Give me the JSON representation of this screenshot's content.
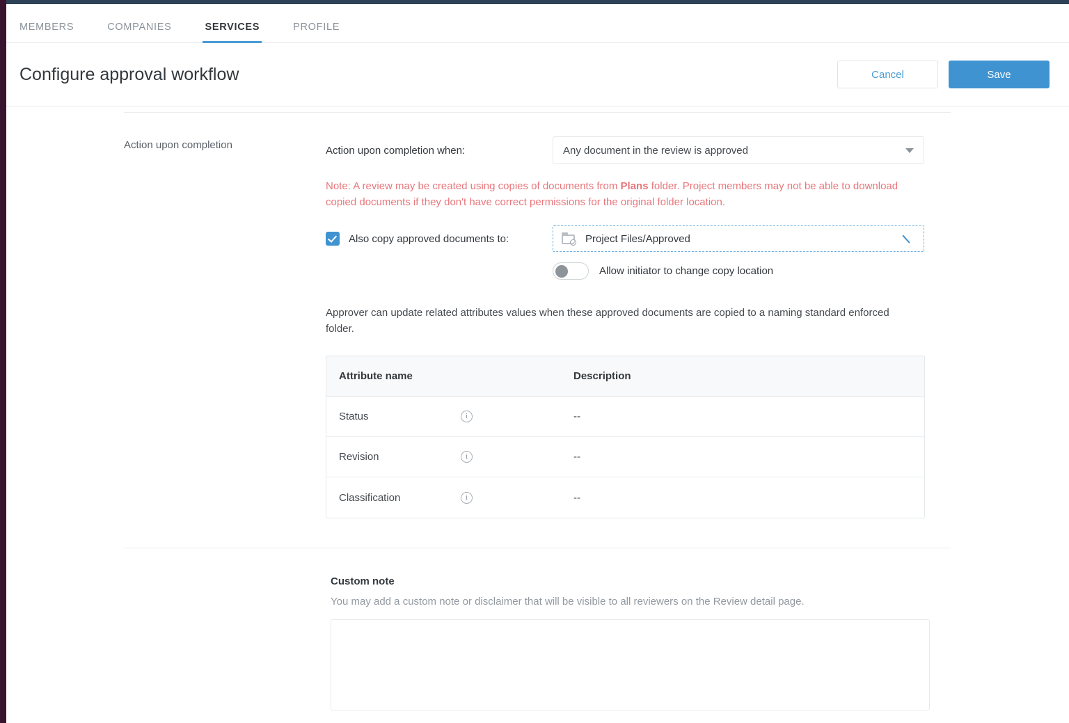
{
  "chrome": {
    "top_bar_color": "#2e4257",
    "left_bar_color": "#38142e"
  },
  "tabs": [
    {
      "label": "MEMBERS",
      "active": false
    },
    {
      "label": "COMPANIES",
      "active": false
    },
    {
      "label": "SERVICES",
      "active": true
    },
    {
      "label": "PROFILE",
      "active": false
    }
  ],
  "header": {
    "title": "Configure approval workflow",
    "cancel_label": "Cancel",
    "save_label": "Save",
    "accent_color": "#3f93d1"
  },
  "section": {
    "label": "Action upon completion",
    "field_label": "Action upon completion when:",
    "select_value": "Any document in the review is approved",
    "note_prefix": "Note: A review may be created using copies of documents from ",
    "note_bold": "Plans",
    "note_suffix": " folder. Project members may not be able to download copied documents if they don't have correct permissions for the original folder location.",
    "note_color": "#e8767b",
    "copy_checkbox_label": "Also copy approved documents to:",
    "copy_checkbox_checked": true,
    "copy_path": "Project Files/Approved",
    "toggle_label": "Allow initiator to change copy location",
    "toggle_on": false,
    "description": "Approver can update related attributes values when these approved documents are copied to a naming standard enforced folder."
  },
  "table": {
    "columns": [
      "Attribute name",
      "Description"
    ],
    "rows": [
      {
        "name": "Status",
        "description": "--"
      },
      {
        "name": "Revision",
        "description": "--"
      },
      {
        "name": "Classification",
        "description": "--"
      }
    ]
  },
  "custom_note": {
    "title": "Custom note",
    "subtitle": "You may add a custom note or disclaimer that will be visible to all reviewers on the Review detail page.",
    "value": ""
  }
}
